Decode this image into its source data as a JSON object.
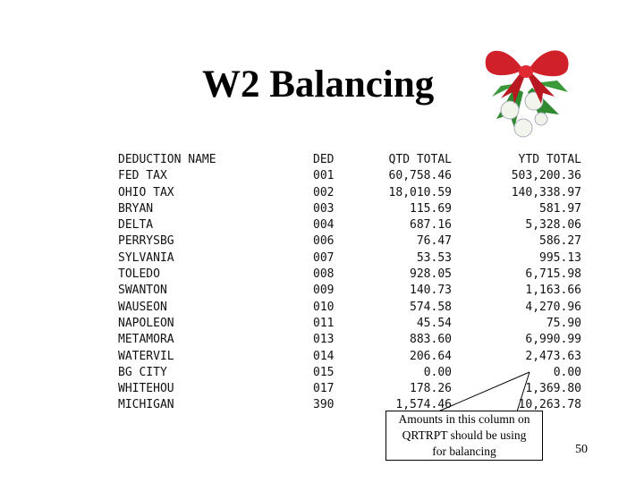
{
  "title": "W2 Balancing",
  "report": {
    "headers": {
      "name": "DEDUCTION NAME",
      "ded": "DED",
      "qtd": "QTD TOTAL",
      "ytd": "YTD TOTAL"
    },
    "rows": [
      {
        "name": "FED TAX",
        "ded": "001",
        "qtd": "60,758.46",
        "ytd": "503,200.36"
      },
      {
        "name": "OHIO TAX",
        "ded": "002",
        "qtd": "18,010.59",
        "ytd": "140,338.97"
      },
      {
        "name": "BRYAN",
        "ded": "003",
        "qtd": "115.69",
        "ytd": "581.97"
      },
      {
        "name": "DELTA",
        "ded": "004",
        "qtd": "687.16",
        "ytd": "5,328.06"
      },
      {
        "name": "PERRYSBG",
        "ded": "006",
        "qtd": "76.47",
        "ytd": "586.27"
      },
      {
        "name": "SYLVANIA",
        "ded": "007",
        "qtd": "53.53",
        "ytd": "995.13"
      },
      {
        "name": "TOLEDO",
        "ded": "008",
        "qtd": "928.05",
        "ytd": "6,715.98"
      },
      {
        "name": "SWANTON",
        "ded": "009",
        "qtd": "140.73",
        "ytd": "1,163.66"
      },
      {
        "name": "WAUSEON",
        "ded": "010",
        "qtd": "574.58",
        "ytd": "4,270.96"
      },
      {
        "name": "NAPOLEON",
        "ded": "011",
        "qtd": "45.54",
        "ytd": "75.90"
      },
      {
        "name": "METAMORA",
        "ded": "013",
        "qtd": "883.60",
        "ytd": "6,990.99"
      },
      {
        "name": "WATERVIL",
        "ded": "014",
        "qtd": "206.64",
        "ytd": "2,473.63"
      },
      {
        "name": "BG CITY",
        "ded": "015",
        "qtd": "0.00",
        "ytd": "0.00"
      },
      {
        "name": "WHITEHOU",
        "ded": "017",
        "qtd": "178.26",
        "ytd": "1,369.80"
      },
      {
        "name": "MICHIGAN",
        "ded": "390",
        "qtd": "1,574.46",
        "ytd": "10,263.78"
      }
    ]
  },
  "callout": {
    "lines": [
      "Amounts in this column on",
      "QRTRPT should be using",
      "for balancing"
    ]
  },
  "page_number": "50",
  "decoration": {
    "icon": "mistletoe-bow-icon",
    "bow_color": "#d0202a",
    "leaf_color": "#2f8a2f"
  }
}
